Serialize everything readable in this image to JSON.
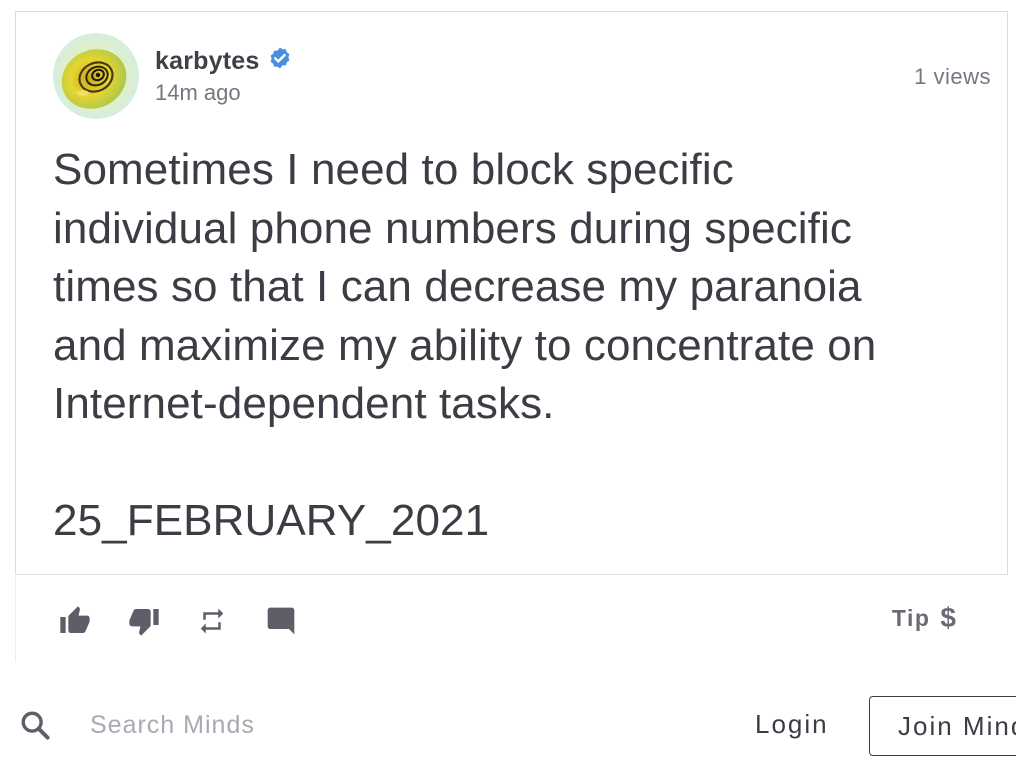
{
  "post": {
    "author": "karbytes",
    "verified": true,
    "timestamp": "14m ago",
    "views": "1 views",
    "text": "Sometimes I need to block specific\nindividual phone numbers during specific\ntimes so that I can decrease my paranoia\nand maximize my ability to concentrate on\nInternet-dependent tasks.\n\n25_FEBRUARY_2021"
  },
  "actions": {
    "icons": [
      "thumb-up-icon",
      "thumb-down-icon",
      "repost-icon",
      "comment-icon"
    ],
    "tip_label": "Tip",
    "tip_symbol": "$"
  },
  "topbar": {
    "search_placeholder": "Search Minds",
    "login_label": "Login",
    "join_label": "Join Minds"
  },
  "colors": {
    "text": "#3c3c45",
    "muted": "#767683",
    "verified": "#4690df",
    "icon": "#5e5e69",
    "border": "#dcdcdc"
  }
}
